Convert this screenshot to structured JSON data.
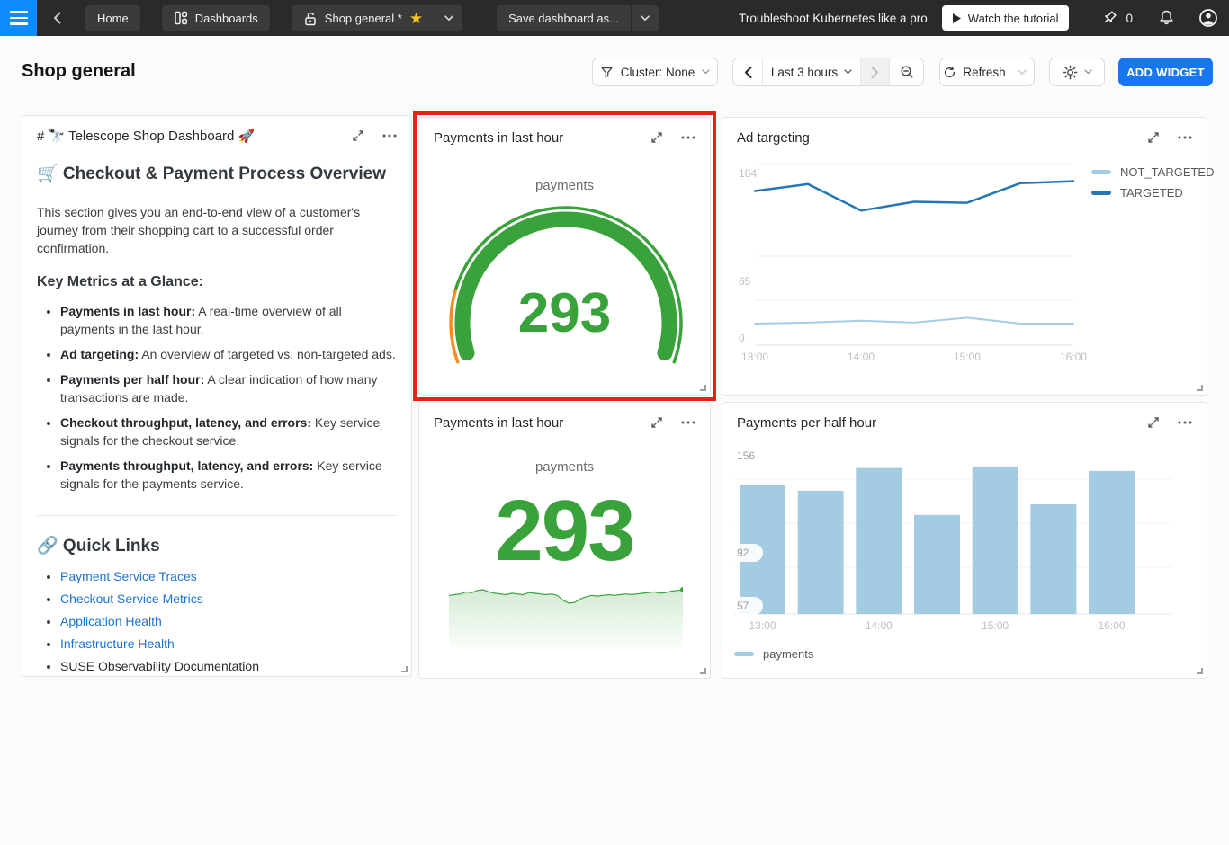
{
  "navbar": {
    "home": "Home",
    "dashboards": "Dashboards",
    "dashboard_name": "Shop general *",
    "save_as": "Save dashboard as...",
    "promo_text": "Troubleshoot Kubernetes like a pro",
    "watch_tutorial": "Watch the tutorial",
    "pin_count": "0"
  },
  "header": {
    "title": "Shop general",
    "cluster_filter": "Cluster: None",
    "time_range": "Last 3 hours",
    "refresh": "Refresh",
    "add_widget": "ADD WIDGET"
  },
  "colors": {
    "accent_blue": "#1677f0",
    "navbar_bg": "#2a2a2a",
    "hamburger_blue": "#0d8bff",
    "green": "#3aa23a",
    "orange": "#f98c1f",
    "bar_blue": "#a3cbe2",
    "line_dark_blue": "#2477b4",
    "line_light_blue": "#a5cde8",
    "link_blue": "#1b74d3",
    "highlight_red": "#e82217",
    "star_yellow": "#f5c51e"
  },
  "widgets": {
    "markdown": {
      "title": "# 🔭 Telescope Shop Dashboard 🚀",
      "heading": "🛒 Checkout & Payment Process Overview",
      "intro": "This section gives you an end-to-end view of a customer's journey from their shopping cart to a successful order confirmation.",
      "metrics_heading": "Key Metrics at a Glance:",
      "bullets": [
        {
          "label": "Payments in last hour:",
          "text": " A real-time overview of all payments in the last hour."
        },
        {
          "label": "Ad targeting:",
          "text": " An overview of targeted vs. non-targeted ads."
        },
        {
          "label": "Payments per half hour:",
          "text": " A clear indication of how many transactions are made."
        },
        {
          "label": "Checkout throughput, latency, and errors:",
          "text": " Key service signals for the checkout service."
        },
        {
          "label": "Payments throughput, latency, and errors:",
          "text": " Key service signals for the payments service."
        }
      ],
      "quick_links_heading": "🔗 Quick Links",
      "links": [
        "Payment Service Traces",
        "Checkout Service Metrics",
        "Application Health",
        "Infrastructure Health",
        "SUSE Observability Documentation"
      ]
    },
    "gauge": {
      "title": "Payments in last hour"
    },
    "ad_targeting": {
      "title": "Ad targeting"
    },
    "big_number": {
      "title": "Payments in last hour"
    },
    "per_half_hour": {
      "title": "Payments per half hour"
    }
  },
  "chart_data": [
    {
      "type": "gauge",
      "title": "Payments in last hour",
      "series_label": "payments",
      "value": 293,
      "color_ok": "#3aa23a",
      "color_warn": "#f98c1f"
    },
    {
      "type": "line",
      "title": "Ad targeting",
      "x": [
        "13:00",
        "13:30",
        "14:00",
        "14:30",
        "15:00",
        "15:30",
        "16:00"
      ],
      "x_tick_labels": [
        "13:00",
        "14:00",
        "15:00",
        "16:00"
      ],
      "series": [
        {
          "name": "NOT_TARGETED",
          "color": "#a5cde8",
          "values": [
            22,
            23,
            25,
            23,
            28,
            22,
            22
          ]
        },
        {
          "name": "TARGETED",
          "color": "#2477b4",
          "values": [
            157,
            164,
            137,
            146,
            145,
            165,
            167
          ]
        }
      ],
      "ylim": [
        0,
        184
      ],
      "yticks": [
        184,
        65,
        0
      ],
      "grid": true,
      "legend_position": "right"
    },
    {
      "type": "area",
      "title": "Payments in last hour",
      "series_label": "payments",
      "value": 293,
      "color": "#3aa23a",
      "values": [
        292,
        292.5,
        293,
        294.5,
        294,
        295.5,
        296,
        294.5,
        293.5,
        293,
        292.5,
        293.5,
        293,
        292.5,
        294,
        293.5,
        293,
        292.5,
        293,
        292,
        288.5,
        286.5,
        287,
        289.5,
        291,
        292,
        291.5,
        292,
        292.5,
        292,
        292.5,
        293,
        292.5,
        293,
        293.5,
        294,
        294.5,
        293.5,
        294,
        295,
        295.5,
        296
      ]
    },
    {
      "type": "bar",
      "title": "Payments per half hour",
      "categories": [
        "13:00",
        "13:30",
        "14:00",
        "14:30",
        "15:00",
        "15:30",
        "16:00"
      ],
      "values": [
        137,
        133,
        148,
        117,
        149,
        124,
        146
      ],
      "x_tick_labels": [
        "13:00",
        "14:00",
        "15:00",
        "16:00"
      ],
      "yticks": [
        156,
        92,
        57
      ],
      "ylim": [
        52,
        160
      ],
      "legend": [
        "payments"
      ],
      "color": "#a3cbe2",
      "grid": true,
      "legend_position": "bottom"
    }
  ]
}
